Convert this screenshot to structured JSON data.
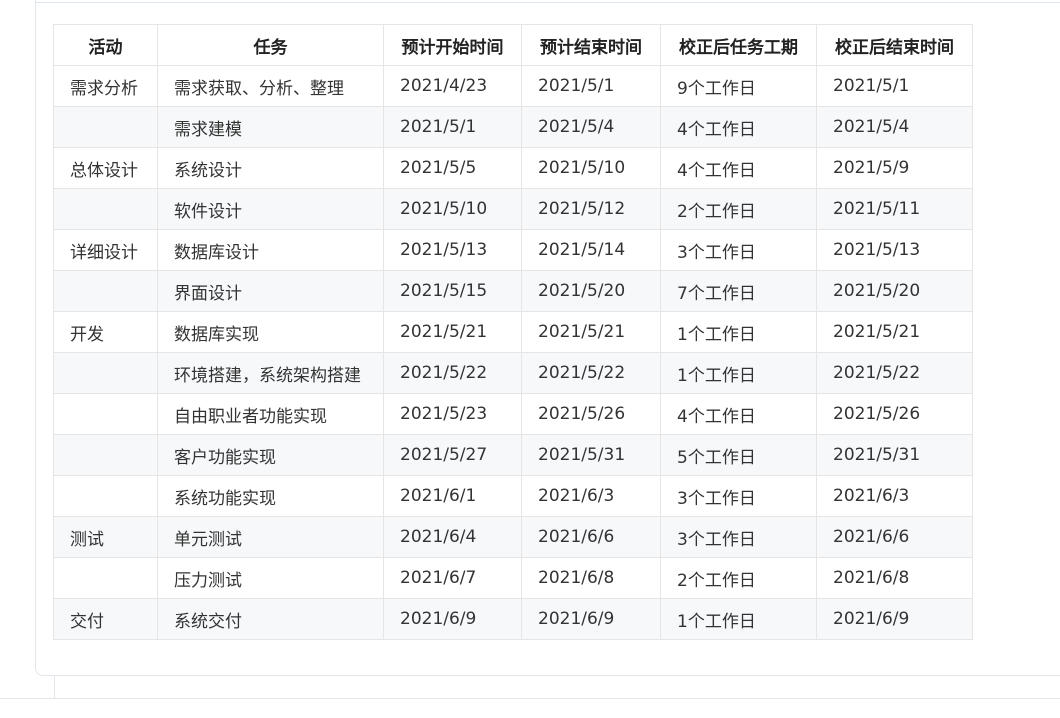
{
  "table": {
    "headers": [
      "活动",
      "任务",
      "预计开始时间",
      "预计结束时间",
      "校正后任务工期",
      "校正后结束时间"
    ],
    "rows": [
      [
        "需求分析",
        "需求获取、分析、整理",
        "2021/4/23",
        "2021/5/1",
        "9个工作日",
        "2021/5/1"
      ],
      [
        "",
        "需求建模",
        "2021/5/1",
        "2021/5/4",
        "4个工作日",
        "2021/5/4"
      ],
      [
        "总体设计",
        "系统设计",
        "2021/5/5",
        "2021/5/10",
        "4个工作日",
        "2021/5/9"
      ],
      [
        "",
        "软件设计",
        "2021/5/10",
        "2021/5/12",
        "2个工作日",
        "2021/5/11"
      ],
      [
        "详细设计",
        "数据库设计",
        "2021/5/13",
        "2021/5/14",
        "3个工作日",
        "2021/5/13"
      ],
      [
        "",
        "界面设计",
        "2021/5/15",
        "2021/5/20",
        "7个工作日",
        "2021/5/20"
      ],
      [
        "开发",
        "数据库实现",
        "2021/5/21",
        "2021/5/21",
        "1个工作日",
        "2021/5/21"
      ],
      [
        "",
        "环境搭建，系统架构搭建",
        "2021/5/22",
        "2021/5/22",
        "1个工作日",
        "2021/5/22"
      ],
      [
        "",
        "自由职业者功能实现",
        "2021/5/23",
        "2021/5/26",
        "4个工作日",
        "2021/5/26"
      ],
      [
        "",
        "客户功能实现",
        "2021/5/27",
        "2021/5/31",
        "5个工作日",
        "2021/5/31"
      ],
      [
        "",
        "系统功能实现",
        "2021/6/1",
        "2021/6/3",
        "3个工作日",
        "2021/6/3"
      ],
      [
        "测试",
        "单元测试",
        "2021/6/4",
        "2021/6/6",
        "3个工作日",
        "2021/6/6"
      ],
      [
        "",
        "压力测试",
        "2021/6/7",
        "2021/6/8",
        "2个工作日",
        "2021/6/8"
      ],
      [
        "交付",
        "系统交付",
        "2021/6/9",
        "2021/6/9",
        "1个工作日",
        "2021/6/9"
      ]
    ]
  }
}
